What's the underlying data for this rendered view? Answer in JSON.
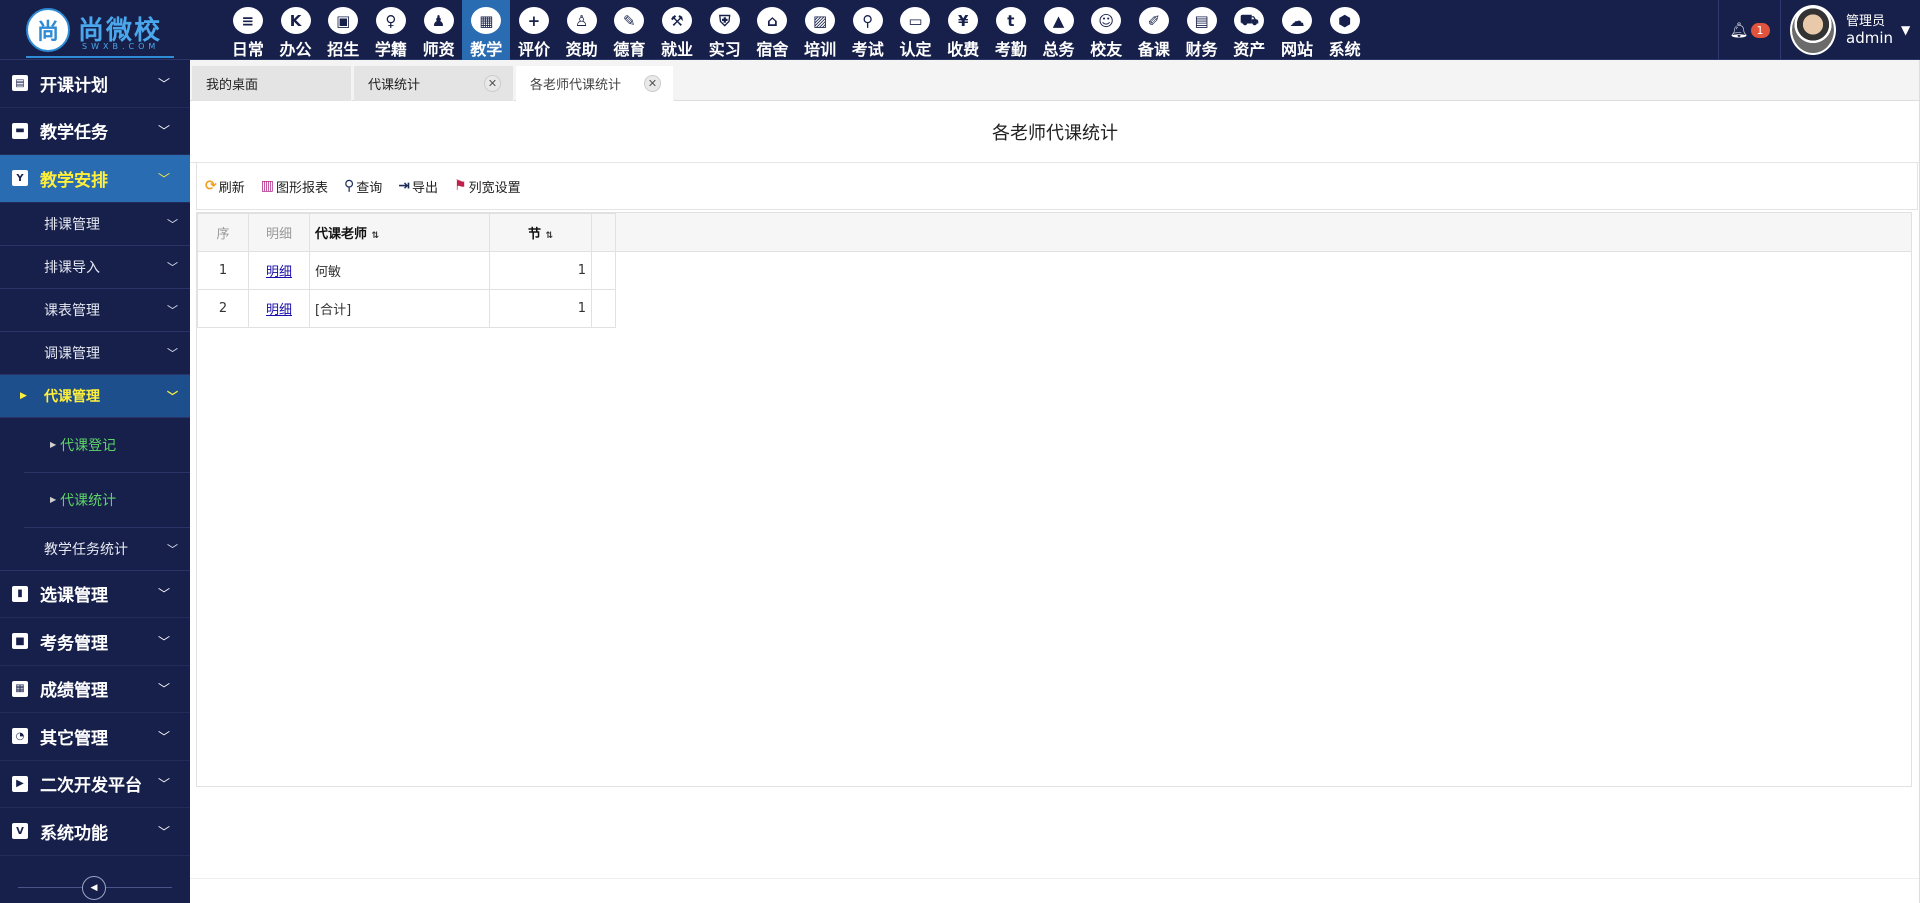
{
  "logo": {
    "mark": "尚",
    "name": "尚微校",
    "sub": "SWXB.COM"
  },
  "menu": [
    {
      "label": "日常",
      "icon": "≡"
    },
    {
      "label": "办公",
      "icon": "K"
    },
    {
      "label": "招生",
      "icon": "▣"
    },
    {
      "label": "学籍",
      "icon": "♀"
    },
    {
      "label": "师资",
      "icon": "♟"
    },
    {
      "label": "教学",
      "icon": "▦",
      "active": true
    },
    {
      "label": "评价",
      "icon": "+"
    },
    {
      "label": "资助",
      "icon": "♙"
    },
    {
      "label": "德育",
      "icon": "✎"
    },
    {
      "label": "就业",
      "icon": "⚒"
    },
    {
      "label": "实习",
      "icon": "⛨"
    },
    {
      "label": "宿舍",
      "icon": "⌂"
    },
    {
      "label": "培训",
      "icon": "▨"
    },
    {
      "label": "考试",
      "icon": "⚲"
    },
    {
      "label": "认定",
      "icon": "▭"
    },
    {
      "label": "收费",
      "icon": "¥"
    },
    {
      "label": "考勤",
      "icon": "t"
    },
    {
      "label": "总务",
      "icon": "▲"
    },
    {
      "label": "校友",
      "icon": "☺"
    },
    {
      "label": "备课",
      "icon": "✐"
    },
    {
      "label": "财务",
      "icon": "▤"
    },
    {
      "label": "资产",
      "icon": "⛟"
    },
    {
      "label": "网站",
      "icon": "☁"
    },
    {
      "label": "系统",
      "icon": "⬢"
    }
  ],
  "notifications": {
    "count": "1"
  },
  "user": {
    "role": "管理员",
    "name": "admin"
  },
  "sidebar": {
    "groups_top": [
      {
        "label": "开课计划",
        "icon": "file-icon"
      },
      {
        "label": "教学任务",
        "icon": "folder-icon"
      },
      {
        "label": "教学安排",
        "icon": "schedule-icon",
        "active": true
      }
    ],
    "subs": [
      {
        "label": "排课管理"
      },
      {
        "label": "排课导入"
      },
      {
        "label": "课表管理"
      },
      {
        "label": "调课管理"
      },
      {
        "label": "代课管理",
        "active": true
      }
    ],
    "leaves": [
      {
        "label": "代课登记"
      },
      {
        "label": "代课统计"
      }
    ],
    "sub_after": {
      "label": "教学任务统计"
    },
    "groups_bottom": [
      {
        "label": "选课管理",
        "icon": "columns-icon"
      },
      {
        "label": "考务管理",
        "icon": "square-icon"
      },
      {
        "label": "成绩管理",
        "icon": "grid-icon"
      },
      {
        "label": "其它管理",
        "icon": "pie-icon"
      },
      {
        "label": "二次开发平台",
        "icon": "play-icon"
      },
      {
        "label": "系统功能",
        "icon": "v-icon"
      }
    ]
  },
  "tabs": [
    {
      "label": "我的桌面"
    },
    {
      "label": "代课统计"
    },
    {
      "label": "各老师代课统计",
      "active": true
    }
  ],
  "page": {
    "title": "各老师代课统计"
  },
  "toolbar": {
    "refresh": "刷新",
    "chart": "图形报表",
    "query": "查询",
    "export": "导出",
    "columns": "列宽设置"
  },
  "grid": {
    "headers": {
      "seq": "序",
      "detail": "明细",
      "teacher": "代课老师",
      "periods": "节"
    },
    "rows": [
      {
        "seq": "1",
        "detail": "明细",
        "teacher": "何敏",
        "periods": "1"
      },
      {
        "seq": "2",
        "detail": "明细",
        "teacher": "[合计]",
        "periods": "1"
      }
    ]
  },
  "colors": {
    "topbar": "#17204a",
    "active_blue": "#2a6cb2",
    "active_text": "#ffef3a",
    "leaf_text": "#5ed46a"
  }
}
